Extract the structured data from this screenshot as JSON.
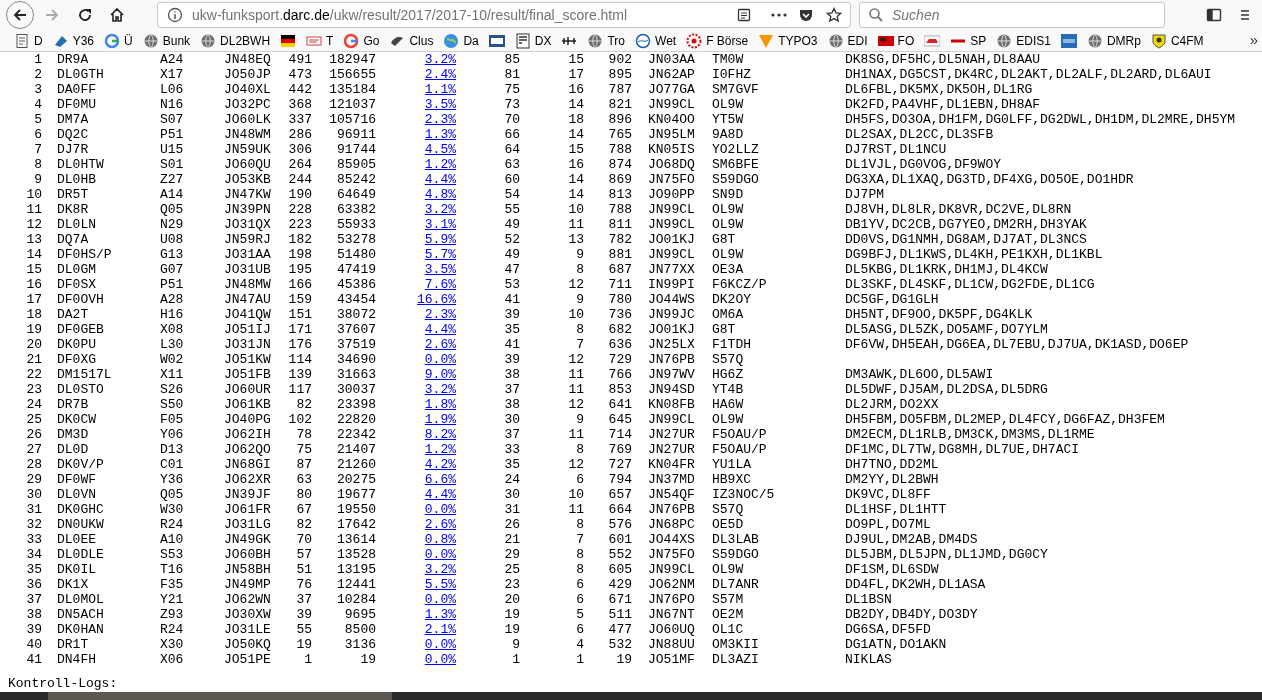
{
  "browser": {
    "url": {
      "subdomain": "ukw-funksport.",
      "domain": "darc.de",
      "path": "/ukw/result/2017/2017-10/result/final_score.html"
    },
    "search": {
      "placeholder": "Suchen"
    },
    "bookmarks": [
      {
        "kind": "link",
        "label": "D"
      },
      {
        "kind": "link",
        "label": "Y36"
      },
      {
        "kind": "link",
        "label": "Ü"
      },
      {
        "kind": "link",
        "label": "Bunk"
      },
      {
        "kind": "link",
        "label": "DL2BWH"
      },
      {
        "kind": "icon"
      },
      {
        "kind": "link",
        "label": "T"
      },
      {
        "kind": "link",
        "label": "Go"
      },
      {
        "kind": "link",
        "label": "Clus"
      },
      {
        "kind": "link",
        "label": "Da"
      },
      {
        "kind": "icon"
      },
      {
        "kind": "link",
        "label": "DX"
      },
      {
        "kind": "icon"
      },
      {
        "kind": "link",
        "label": "Tro"
      },
      {
        "kind": "link",
        "label": "Wet"
      },
      {
        "kind": "link",
        "label": "F Börse"
      },
      {
        "kind": "link",
        "label": "TYPO3"
      },
      {
        "kind": "link",
        "label": "EDI"
      },
      {
        "kind": "link",
        "label": "FO"
      },
      {
        "kind": "icon"
      },
      {
        "kind": "link",
        "label": "SP"
      },
      {
        "kind": "link",
        "label": "EDIS1"
      },
      {
        "kind": "icon"
      },
      {
        "kind": "link",
        "label": "DMRp"
      },
      {
        "kind": "link",
        "label": "C4FM"
      }
    ],
    "overflow": "»"
  },
  "table": {
    "rows": [
      [
        "1",
        "DR9A",
        "A24",
        "JN48EQ",
        "491",
        "182947",
        "3.2%",
        "85",
        "15",
        "902",
        "JN03AA",
        "TM0W",
        "DK8SG,DF5HC,DL5NAH,DL8AAU"
      ],
      [
        "2",
        "DL0GTH",
        "X17",
        "JO50JP",
        "473",
        "156655",
        "2.4%",
        "81",
        "17",
        "895",
        "JN62AP",
        "I0FHZ",
        "DH1NAX,DG5CST,DK4RC,DL2AKT,DL2ALF,DL2ARD,DL6AUI"
      ],
      [
        "3",
        "DA0FF",
        "L06",
        "JO40XL",
        "442",
        "135184",
        "1.1%",
        "75",
        "16",
        "787",
        "JO77GA",
        "SM7GVF",
        "DL6FBL,DK5MX,DK5OH,DL1RG"
      ],
      [
        "4",
        "DF0MU",
        "N16",
        "JO32PC",
        "368",
        "121037",
        "3.5%",
        "73",
        "14",
        "821",
        "JN99CL",
        "OL9W",
        "DK2FD,PA4VHF,DL1EBN,DH8AF"
      ],
      [
        "5",
        "DM7A",
        "S07",
        "JO60LK",
        "337",
        "105716",
        "2.3%",
        "70",
        "18",
        "896",
        "KN04OO",
        "YT5W",
        "DH5FS,DO3OA,DH1FM,DG0LFF,DG2DWL,DH1DM,DL2MRE,DH5YM"
      ],
      [
        "6",
        "DQ2C",
        "P51",
        "JN48WM",
        "286",
        "96911",
        "1.3%",
        "66",
        "14",
        "765",
        "JN95LM",
        "9A8D",
        "DL2SAX,DL2CC,DL3SFB"
      ],
      [
        "7",
        "DJ7R",
        "U15",
        "JN59UK",
        "306",
        "91744",
        "4.5%",
        "64",
        "15",
        "788",
        "KN05IS",
        "YO2LLZ",
        "DJ7RST,DL1NCU"
      ],
      [
        "8",
        "DL0HTW",
        "S01",
        "JO60QU",
        "264",
        "85905",
        "1.2%",
        "63",
        "16",
        "874",
        "JO68DQ",
        "SM6BFE",
        "DL1VJL,DG0VOG,DF9WOY"
      ],
      [
        "9",
        "DL0HB",
        "Z27",
        "JO53KB",
        "244",
        "85242",
        "4.4%",
        "60",
        "14",
        "869",
        "JN75FO",
        "S59DGO",
        "DG3XA,DL1XAQ,DG3TD,DF4XG,DO5OE,DO1HDR"
      ],
      [
        "10",
        "DR5T",
        "A14",
        "JN47KW",
        "190",
        "64649",
        "4.8%",
        "54",
        "14",
        "813",
        "JO90PP",
        "SN9D",
        "DJ7PM"
      ],
      [
        "11",
        "DK8R",
        "Q05",
        "JN39PN",
        "228",
        "63382",
        "3.2%",
        "55",
        "10",
        "788",
        "JN99CL",
        "OL9W",
        "DJ8VH,DL8LR,DK8VR,DC2VE,DL8RN"
      ],
      [
        "12",
        "DL0LN",
        "N29",
        "JO31QX",
        "223",
        "55933",
        "3.1%",
        "49",
        "11",
        "811",
        "JN99CL",
        "OL9W",
        "DB1YV,DC2CB,DG7YEO,DM2RH,DH3YAK"
      ],
      [
        "13",
        "DQ7A",
        "U08",
        "JN59RJ",
        "182",
        "53278",
        "5.9%",
        "52",
        "13",
        "782",
        "JO01KJ",
        "G8T",
        "DD0VS,DG1NMH,DG8AM,DJ7AT,DL3NCS"
      ],
      [
        "14",
        "DF0HS/P",
        "G13",
        "JO31AA",
        "198",
        "51480",
        "5.7%",
        "49",
        "9",
        "881",
        "JN99CL",
        "OL9W",
        "DG9BFJ,DL1KWS,DL4KH,PE1KXH,DL1KBL"
      ],
      [
        "15",
        "DL0GM",
        "G07",
        "JO31UB",
        "195",
        "47419",
        "3.5%",
        "47",
        "8",
        "687",
        "JN77XX",
        "OE3A",
        "DL5KBG,DL1KRK,DH1MJ,DL4KCW"
      ],
      [
        "16",
        "DF0SX",
        "P51",
        "JN48MW",
        "166",
        "45386",
        "7.6%",
        "53",
        "12",
        "711",
        "IN99PI",
        "F6KCZ/P",
        "DL3SKF,DL4SKF,DL1CW,DG2FDE,DL1CG"
      ],
      [
        "17",
        "DF0OVH",
        "A28",
        "JN47AU",
        "159",
        "43454",
        "16.6%",
        "41",
        "9",
        "780",
        "JO44WS",
        "DK2OY",
        "DC5GF,DG1GLH"
      ],
      [
        "18",
        "DA2T",
        "H16",
        "JO41QW",
        "151",
        "38072",
        "2.3%",
        "39",
        "10",
        "736",
        "JN99JC",
        "OM6A",
        "DH5NT,DF9OO,DK5PF,DG4KLK"
      ],
      [
        "19",
        "DF0GEB",
        "X08",
        "JO51IJ",
        "171",
        "37607",
        "4.4%",
        "35",
        "8",
        "682",
        "JO01KJ",
        "G8T",
        "DL5ASG,DL5ZK,DO5AMF,DO7YLM"
      ],
      [
        "20",
        "DK0PU",
        "L30",
        "JO31JN",
        "176",
        "37519",
        "2.6%",
        "41",
        "7",
        "636",
        "JN25LX",
        "F1TDH",
        "DF6VW,DH5EAH,DG6EA,DL7EBU,DJ7UA,DK1ASD,DO6EP"
      ],
      [
        "21",
        "DF0XG",
        "W02",
        "JO51KW",
        "114",
        "34690",
        "0.0%",
        "39",
        "12",
        "729",
        "JN76PB",
        "S57Q"
      ],
      [
        "22",
        "DM1517L",
        "X11",
        "JO51FB",
        "139",
        "31663",
        "9.0%",
        "38",
        "11",
        "766",
        "JN97WV",
        "HG6Z",
        "DM3AWK,DL6OO,DL5AWI"
      ],
      [
        "23",
        "DL0STO",
        "S26",
        "JO60UR",
        "117",
        "30037",
        "3.2%",
        "37",
        "11",
        "853",
        "JN94SD",
        "YT4B",
        "DL5DWF,DJ5AM,DL2DSA,DL5DRG"
      ],
      [
        "24",
        "DR7B",
        "S50",
        "JO61KB",
        "82",
        "23398",
        "1.8%",
        "38",
        "12",
        "641",
        "KN08FB",
        "HA6W",
        "DL2JRM,DO2XX"
      ],
      [
        "25",
        "DK0CW",
        "F05",
        "JO40PG",
        "102",
        "22820",
        "1.9%",
        "30",
        "9",
        "645",
        "JN99CL",
        "OL9W",
        "DH5FBM,DO5FBM,DL2MEP,DL4FCY,DG6FAZ,DH3FEM"
      ],
      [
        "26",
        "DM3D",
        "Y06",
        "JO62IH",
        "78",
        "22342",
        "8.2%",
        "37",
        "11",
        "714",
        "JN27UR",
        "F5OAU/P",
        "DM2ECM,DL1RLB,DM3CK,DM3MS,DL1RME"
      ],
      [
        "27",
        "DL0D",
        "D13",
        "JO62QO",
        "75",
        "21407",
        "1.2%",
        "33",
        "8",
        "769",
        "JN27UR",
        "F5OAU/P",
        "DF1MC,DL7TW,DG8MH,DL7UE,DH7ACI"
      ],
      [
        "28",
        "DK0V/P",
        "C01",
        "JN68GI",
        "87",
        "21260",
        "4.2%",
        "35",
        "12",
        "727",
        "KN04FR",
        "YU1LA",
        "DH7TNO,DD2ML"
      ],
      [
        "29",
        "DF0WF",
        "Y36",
        "JO62XR",
        "63",
        "20275",
        "6.6%",
        "24",
        "6",
        "794",
        "JN37MD",
        "HB9XC",
        "DM2YY,DL2BWH"
      ],
      [
        "30",
        "DL0VN",
        "Q05",
        "JN39JF",
        "80",
        "19677",
        "4.4%",
        "30",
        "10",
        "657",
        "JN54QF",
        "IZ3NOC/5",
        "DK9VC,DL8FF"
      ],
      [
        "31",
        "DK0GHC",
        "W30",
        "JO61FR",
        "67",
        "19550",
        "0.0%",
        "31",
        "11",
        "664",
        "JN76PB",
        "S57Q",
        "DL1HSF,DL1HTT"
      ],
      [
        "32",
        "DN0UKW",
        "R24",
        "JO31LG",
        "82",
        "17642",
        "2.6%",
        "26",
        "8",
        "576",
        "JN68PC",
        "OE5D",
        "DO9PL,DO7ML"
      ],
      [
        "33",
        "DL0EE",
        "A10",
        "JN49GK",
        "70",
        "13614",
        "0.8%",
        "21",
        "7",
        "601",
        "JO44XS",
        "DL3LAB",
        "DJ9UL,DM2AB,DM4DS"
      ],
      [
        "34",
        "DL0DLE",
        "S53",
        "JO60BH",
        "57",
        "13528",
        "0.0%",
        "29",
        "8",
        "552",
        "JN75FO",
        "S59DGO",
        "DL5JBM,DL5JPN,DL1JMD,DG0CY"
      ],
      [
        "35",
        "DK0IL",
        "T16",
        "JN58BH",
        "51",
        "13195",
        "3.2%",
        "25",
        "8",
        "605",
        "JN99CL",
        "OL9W",
        "DF1SM,DL6SDW"
      ],
      [
        "36",
        "DK1X",
        "F35",
        "JN49MP",
        "76",
        "12441",
        "5.5%",
        "23",
        "6",
        "429",
        "JO62NM",
        "DL7ANR",
        "DD4FL,DK2WH,DL1ASA"
      ],
      [
        "37",
        "DL0MOL",
        "Y21",
        "JO62WN",
        "37",
        "10284",
        "0.0%",
        "20",
        "6",
        "671",
        "JN76PO",
        "S57M",
        "DL1BSN"
      ],
      [
        "38",
        "DN5ACH",
        "Z93",
        "JO30XW",
        "39",
        "9695",
        "1.3%",
        "19",
        "5",
        "511",
        "JN67NT",
        "OE2M",
        "DB2DY,DB4DY,DO3DY"
      ],
      [
        "39",
        "DK0HAN",
        "R24",
        "JO31LE",
        "55",
        "8500",
        "2.1%",
        "19",
        "6",
        "477",
        "JO60UQ",
        "OL1C",
        "DG6SA,DF5FD"
      ],
      [
        "40",
        "DR1T",
        "X30",
        "JO50KQ",
        "19",
        "3136",
        "0.0%",
        "9",
        "4",
        "532",
        "JN88UU",
        "OM3KII",
        "DG1ATN,DO1AKN"
      ],
      [
        "41",
        "DN4FH",
        "X06",
        "JO51PE",
        "1",
        "19",
        "0.0%",
        "1",
        "1",
        "19",
        "JO51MF",
        "DL3AZI",
        "NIKLAS"
      ]
    ]
  },
  "footer_heading": "Kontroll-Logs:"
}
